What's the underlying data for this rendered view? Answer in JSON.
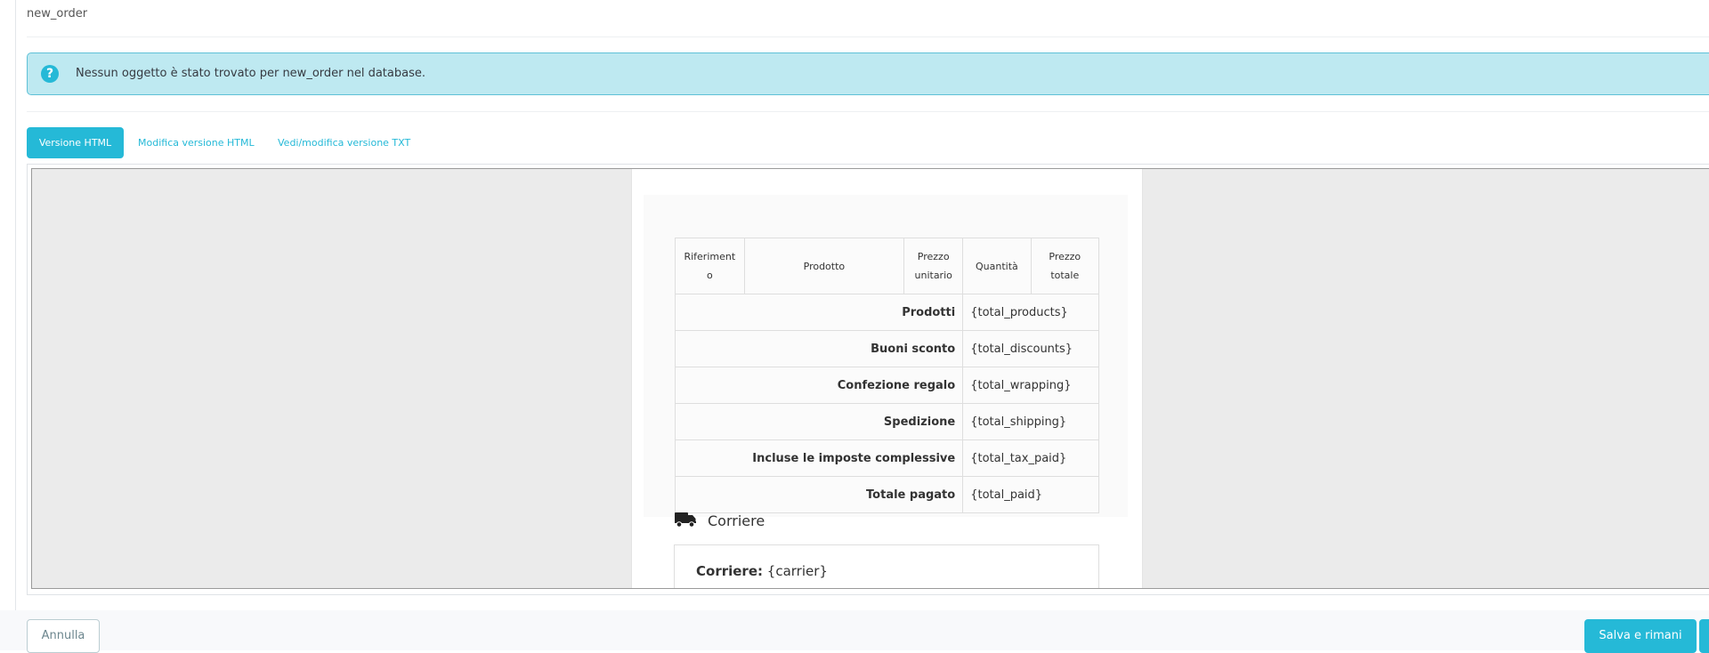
{
  "template_name": "new_order",
  "alert": {
    "icon": "question-icon",
    "text": "Nessun oggetto è stato trovato per new_order nel database."
  },
  "tabs": [
    {
      "label": "Versione HTML",
      "active": true
    },
    {
      "label": "Modifica versione HTML",
      "active": false
    },
    {
      "label": "Vedi/modifica versione TXT",
      "active": false
    }
  ],
  "order_table": {
    "headers": {
      "reference_line1": "Riferiment",
      "reference_line2": "o",
      "product": "Prodotto",
      "unit_price_line1": "Prezzo",
      "unit_price_line2": "unitario",
      "quantity": "Quantità",
      "total_price_line1": "Prezzo",
      "total_price_line2": "totale"
    },
    "rows": [
      {
        "label": "Prodotti",
        "value": "{total_products}"
      },
      {
        "label": "Buoni sconto",
        "value": "{total_discounts}"
      },
      {
        "label": "Confezione regalo",
        "value": "{total_wrapping}"
      },
      {
        "label": "Spedizione",
        "value": "{total_shipping}"
      },
      {
        "label": "Incluse le imposte complessive",
        "value": "{total_tax_paid}"
      },
      {
        "label": "Totale pagato",
        "value": "{total_paid}"
      }
    ]
  },
  "carrier": {
    "icon": "truck-icon",
    "title": "Corriere",
    "label": "Corriere:",
    "value": "{carrier}"
  },
  "footer": {
    "cancel_label": "Annulla",
    "save_stay_label": "Salva e rimani"
  },
  "colors": {
    "accent": "#25b9d7",
    "alert_background": "#bee9f1"
  }
}
